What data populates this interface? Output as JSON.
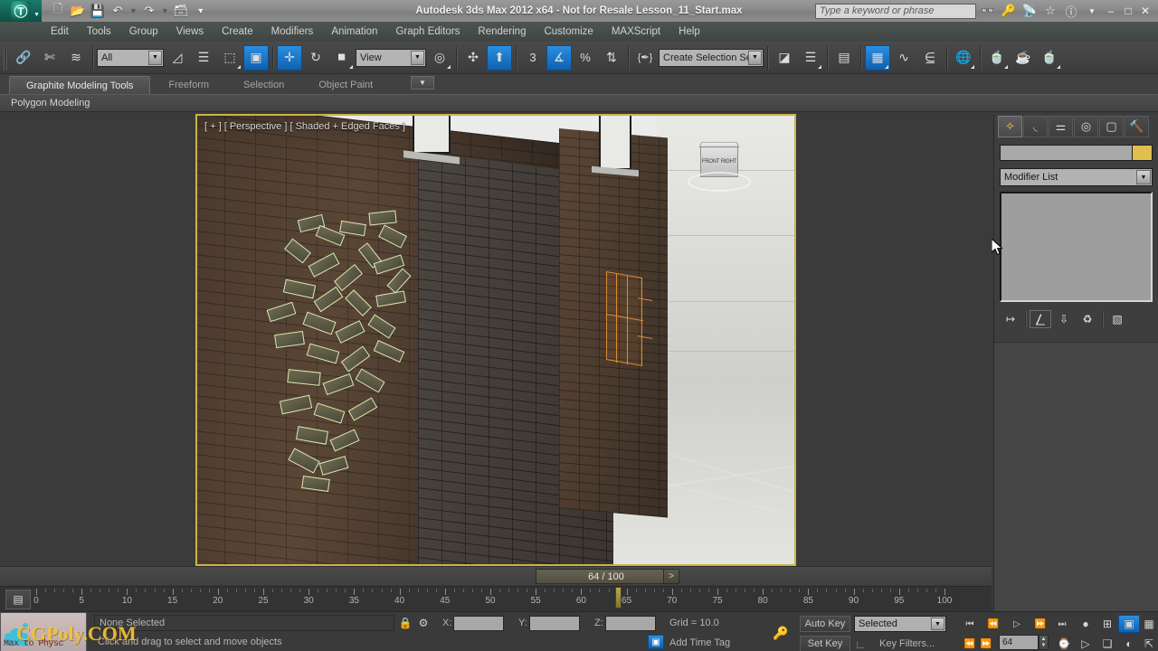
{
  "titlebar": {
    "app_menu_icon": "3dsmax-logo-icon",
    "title": "Autodesk 3ds Max  2012 x64  - Not for Resale   Lesson_11_Start.max",
    "quick_access": [
      {
        "name": "new-file-icon",
        "glyph": "▢"
      },
      {
        "name": "open-file-icon",
        "glyph": "▱"
      },
      {
        "name": "save-file-icon",
        "glyph": "▣"
      },
      {
        "name": "undo-icon",
        "glyph": "↶"
      },
      {
        "name": "undo-dropdown-icon",
        "glyph": "▾"
      },
      {
        "name": "redo-icon",
        "glyph": "↷"
      },
      {
        "name": "redo-dropdown-icon",
        "glyph": "▾"
      },
      {
        "name": "set-project-folder-icon",
        "glyph": "❐"
      },
      {
        "name": "customize-qat-icon",
        "glyph": "▾"
      }
    ],
    "search_placeholder": "Type a keyword or phrase",
    "right_icons": [
      {
        "name": "infocenter-search-icon",
        "glyph": "☊"
      },
      {
        "name": "subscription-key-icon",
        "glyph": "⚷"
      },
      {
        "name": "communication-center-icon",
        "glyph": "◠"
      },
      {
        "name": "favorites-star-icon",
        "glyph": "☆"
      },
      {
        "name": "help-icon",
        "glyph": "?"
      },
      {
        "name": "help-dropdown-icon",
        "glyph": "▾"
      }
    ],
    "window_buttons": [
      {
        "name": "minimize-button",
        "glyph": "–"
      },
      {
        "name": "maximize-button",
        "glyph": "□"
      },
      {
        "name": "close-button",
        "glyph": "✕"
      }
    ]
  },
  "menubar": {
    "items": [
      {
        "label": "Edit"
      },
      {
        "label": "Tools"
      },
      {
        "label": "Group"
      },
      {
        "label": "Views"
      },
      {
        "label": "Create"
      },
      {
        "label": "Modifiers"
      },
      {
        "label": "Animation"
      },
      {
        "label": "Graph Editors"
      },
      {
        "label": "Rendering"
      },
      {
        "label": "Customize"
      },
      {
        "label": "MAXScript"
      },
      {
        "label": "Help"
      }
    ]
  },
  "toolbar": {
    "selection_filter_value": "All",
    "reference_coordinate_value": "View",
    "named_selection_set_value": "Create Selection Set",
    "snap_percent_label": "%",
    "snap_angle_label": "3",
    "buttons": [
      {
        "name": "select-and-link-icon",
        "glyph": "⧉",
        "state": "off"
      },
      {
        "name": "unlink-selection-icon",
        "glyph": "✄",
        "state": "off"
      },
      {
        "name": "bind-to-space-warp-icon",
        "glyph": "≋",
        "state": "off"
      },
      {
        "name": "select-object-icon",
        "glyph": "⬚",
        "state": "off"
      },
      {
        "name": "select-by-name-icon",
        "glyph": "☰",
        "state": "off"
      },
      {
        "name": "rectangular-selection-region-icon",
        "glyph": "⬚",
        "state": "off"
      },
      {
        "name": "window-crossing-toggle-icon",
        "glyph": "▣",
        "state": "on"
      },
      {
        "name": "select-and-move-icon",
        "glyph": "✛",
        "state": "on"
      },
      {
        "name": "select-and-rotate-icon",
        "glyph": "↻",
        "state": "off"
      },
      {
        "name": "select-and-scale-icon",
        "glyph": "◰",
        "state": "off"
      },
      {
        "name": "use-center-flyout-icon",
        "glyph": "⬟",
        "state": "off"
      },
      {
        "name": "select-and-manipulate-icon",
        "glyph": "✣",
        "state": "off"
      },
      {
        "name": "snaps-toggle-icon",
        "glyph": "⬆",
        "state": "on"
      },
      {
        "name": "angle-snap-toggle-icon",
        "glyph": "∠",
        "state": "on"
      },
      {
        "name": "percent-snap-toggle-icon",
        "glyph": "%",
        "state": "off"
      },
      {
        "name": "spinner-snap-toggle-icon",
        "glyph": "⇅",
        "state": "off"
      },
      {
        "name": "edit-named-selection-sets-icon",
        "glyph": "{✐}",
        "state": "off"
      },
      {
        "name": "mirror-icon",
        "glyph": "◧◨",
        "state": "off"
      },
      {
        "name": "align-icon",
        "glyph": "≡",
        "state": "off"
      },
      {
        "name": "layer-manager-icon",
        "glyph": "▤",
        "state": "off"
      },
      {
        "name": "material-editor-icon",
        "glyph": "▨",
        "state": "on"
      },
      {
        "name": "curve-editor-icon",
        "glyph": "∿",
        "state": "off"
      },
      {
        "name": "schematic-view-icon",
        "glyph": "⌸",
        "state": "off"
      },
      {
        "name": "render-setup-icon",
        "glyph": "⌘",
        "state": "off"
      },
      {
        "name": "rendered-frame-window-icon",
        "glyph": "◔",
        "state": "off"
      },
      {
        "name": "render-production-icon",
        "glyph": "◑",
        "state": "off"
      },
      {
        "name": "render-iterative-icon",
        "glyph": "◕",
        "state": "off"
      }
    ]
  },
  "ribbon": {
    "tabs": [
      {
        "label": "Graphite Modeling Tools",
        "active": true
      },
      {
        "label": "Freeform",
        "active": false
      },
      {
        "label": "Selection",
        "active": false
      },
      {
        "label": "Object Paint",
        "active": false
      }
    ],
    "panel_label": "Polygon Modeling",
    "minimize_icon": "chevron-down-icon"
  },
  "viewport": {
    "label": "[ + ] [ Perspective ] [ Shaded + Edged Faces ]",
    "viewcube": {
      "front_face": "FRONT",
      "right_face": "RIGHT"
    },
    "home_icon": "home-icon",
    "cursor_icon": "mouse-cursor-icon"
  },
  "command_panel": {
    "tabs": [
      {
        "name": "create-tab",
        "glyph": "☀",
        "active": true
      },
      {
        "name": "modify-tab",
        "glyph": "◜",
        "active": false
      },
      {
        "name": "hierarchy-tab",
        "glyph": "⑂",
        "active": false
      },
      {
        "name": "motion-tab",
        "glyph": "◎",
        "active": false
      },
      {
        "name": "display-tab",
        "glyph": "▢",
        "active": false
      },
      {
        "name": "utilities-tab",
        "glyph": "⚒",
        "active": false
      }
    ],
    "object_name_value": "",
    "object_color": "#e0bf4e",
    "modifier_list_label": "Modifier List",
    "stack_tools": [
      {
        "name": "pin-stack-icon",
        "glyph": "↦"
      },
      {
        "name": "show-end-result-icon",
        "glyph": "⎉"
      },
      {
        "name": "make-unique-icon",
        "glyph": "⬇"
      },
      {
        "name": "remove-modifier-icon",
        "glyph": "♻"
      },
      {
        "name": "configure-modifier-sets-icon",
        "glyph": "☷"
      }
    ]
  },
  "time_slider": {
    "current_frame_label": "64 / 100",
    "prev_frame_label": "<",
    "next_frame_label": ">",
    "current_frame": 64,
    "total_frames": 100,
    "ruler_major_labels": [
      0,
      5,
      10,
      15,
      20,
      25,
      30,
      35,
      40,
      45,
      50,
      55,
      60,
      65,
      70,
      75,
      80,
      85,
      90,
      95,
      100
    ],
    "open_mini_curve_editor_icon": "mini-curve-editor-icon"
  },
  "status_bar": {
    "selection_status": "None Selected",
    "prompt": "Click and drag to select and move objects",
    "lock_icon": "lock-selection-icon",
    "absolute_mode_icon": "absolute-relative-transform-icon",
    "coords": [
      {
        "axis": "X:",
        "value": ""
      },
      {
        "axis": "Y:",
        "value": ""
      },
      {
        "axis": "Z:",
        "value": ""
      }
    ],
    "grid_label": "Grid = 10.0",
    "add_time_tag_label": "Add Time Tag",
    "time_tag_icon": "time-tag-icon",
    "key_mode_icon": "key-mode-icon",
    "auto_key_label": "Auto Key",
    "set_key_label": "Set Key",
    "set_key_filter_value": "Selected",
    "key_filters_label": "Key Filters...",
    "set_key_icon": "set-key-arc-icon",
    "current_frame_field": "64",
    "playback_buttons": [
      {
        "name": "go-to-start-button",
        "glyph": "⏮"
      },
      {
        "name": "previous-frame-button",
        "glyph": "⏴❙"
      },
      {
        "name": "play-animation-button",
        "glyph": "▷"
      },
      {
        "name": "next-frame-button",
        "glyph": "❙⏵"
      },
      {
        "name": "go-to-end-button",
        "glyph": "⏭"
      }
    ],
    "key_nav_buttons": [
      {
        "name": "previous-key-button",
        "glyph": "⏴"
      },
      {
        "name": "next-key-button",
        "glyph": "⏵"
      }
    ],
    "animation_tools": [
      {
        "name": "key-mode-toggle-icon",
        "glyph": "⚷"
      },
      {
        "name": "time-configuration-icon",
        "glyph": "⌚"
      },
      {
        "name": "select-region-icon",
        "glyph": "⬚"
      },
      {
        "name": "maximize-viewport-toggle-icon",
        "glyph": "⛶"
      }
    ],
    "nav_buttons": [
      {
        "name": "zoom-icon",
        "glyph": "⌕"
      },
      {
        "name": "zoom-all-icon",
        "glyph": "⊞"
      },
      {
        "name": "zoom-extents-icon",
        "glyph": "⛶"
      },
      {
        "name": "zoom-region-icon",
        "glyph": "⬚"
      },
      {
        "name": "pan-view-icon",
        "glyph": "✋"
      },
      {
        "name": "orbit-icon",
        "glyph": "◔"
      },
      {
        "name": "maximize-viewport-icon",
        "glyph": "⤡"
      }
    ]
  },
  "watermark": {
    "text": "CGPoly.COM",
    "badge_text": "Max to Physc"
  }
}
